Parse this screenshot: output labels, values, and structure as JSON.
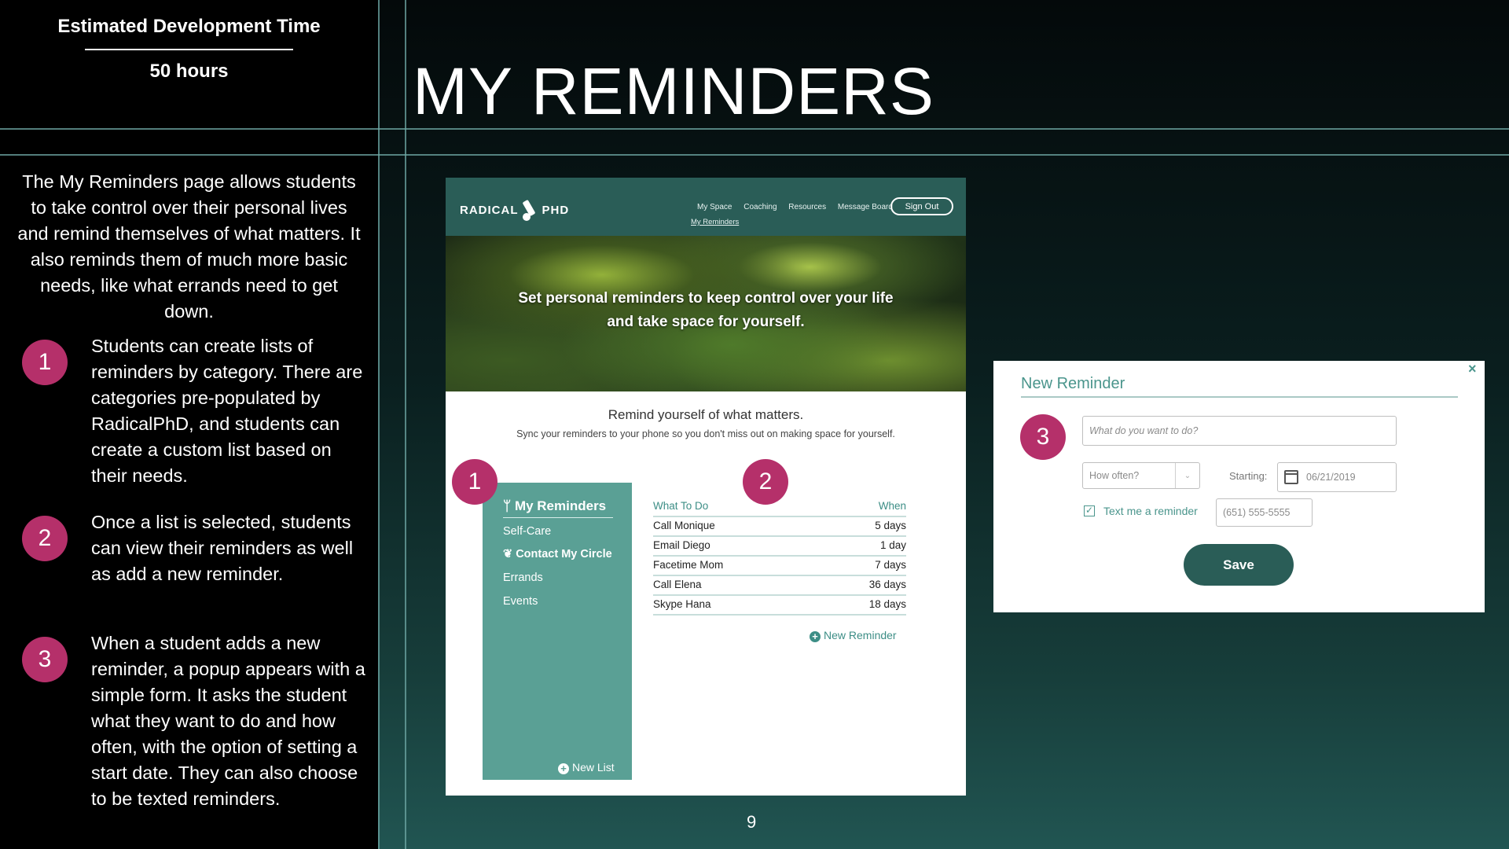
{
  "sidebar": {
    "estimate_title": "Estimated Development Time",
    "estimate_hours": "50 hours",
    "intro": "The My Reminders page allows students to take control over their personal lives and remind themselves of what matters. It also reminds them of much more basic needs, like what errands need to get down.",
    "points": [
      {
        "num": "1",
        "text": "Students can create lists of reminders by category. There are categories pre-populated by RadicalPhD, and students can create a custom list based on their needs."
      },
      {
        "num": "2",
        "text": "Once a list is selected, students can view their reminders as well as add a new reminder."
      },
      {
        "num": "3",
        "text": "When a student adds a new reminder, a popup appears with a simple form. It asks the student what they want to do and how often, with the option of setting a start date. They can also choose to be texted reminders."
      }
    ]
  },
  "slide": {
    "title": "MY REMINDERS",
    "page_number": "9"
  },
  "mockup": {
    "logo_left": "RADICAL",
    "logo_right": "PHD",
    "nav": [
      "My Space",
      "Coaching",
      "Resources",
      "Message Board"
    ],
    "nav_sub": "My Reminders",
    "sign_out": "Sign Out",
    "hero_line1": "Set personal reminders to keep control over your life",
    "hero_line2": "and take space for yourself.",
    "remind_head": "Remind yourself of what matters.",
    "remind_sub": "Sync your reminders to your phone so you don't miss out on making space for yourself.",
    "lists": {
      "title": "My Reminders",
      "items": [
        "Self-Care",
        "Contact My Circle",
        "Errands",
        "Events"
      ],
      "new_list": "New List"
    },
    "todo": {
      "col_what": "What To Do",
      "col_when": "When",
      "rows": [
        {
          "what": "Call Monique",
          "when": "5 days"
        },
        {
          "what": "Email Diego",
          "when": "1 day"
        },
        {
          "what": "Facetime Mom",
          "when": "7 days"
        },
        {
          "what": "Call Elena",
          "when": "36 days"
        },
        {
          "what": "Skype Hana",
          "when": "18 days"
        }
      ],
      "new_reminder": "New Reminder"
    },
    "badges": [
      "1",
      "2"
    ]
  },
  "popup": {
    "title": "New Reminder",
    "close": "×",
    "badge": "3",
    "what_placeholder": "What do you want to do?",
    "how_often": "How often?",
    "starting_label": "Starting:",
    "start_date": "06/21/2019",
    "text_me_label": "Text me a reminder",
    "phone": "(651) 555-5555",
    "save": "Save"
  },
  "colors": {
    "accent": "#b5306a",
    "brand_dark": "#2a5d57",
    "brand_mid": "#5aa095",
    "brand_text": "#4a958c"
  }
}
